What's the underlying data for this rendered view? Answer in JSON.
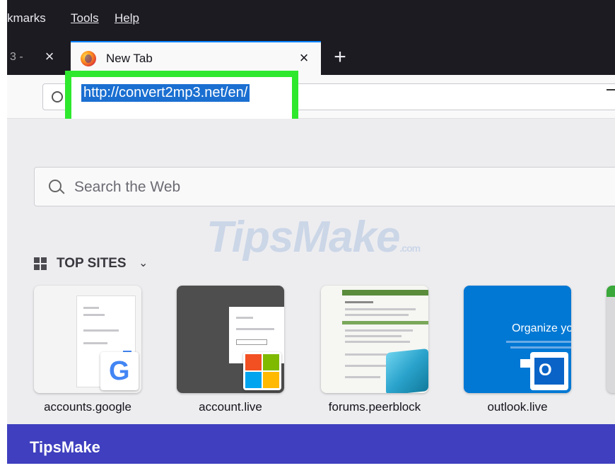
{
  "menu": {
    "items": [
      "kmarks",
      "Tools",
      "Help"
    ]
  },
  "tabs": {
    "previous_tab_fragment": "3 -",
    "active_tab_title": "New Tab",
    "new_tab_symbol": "+",
    "close_symbol": "×"
  },
  "urlbar": {
    "url": "http://convert2mp3.net/en/"
  },
  "newtab": {
    "search_placeholder": "Search the Web",
    "watermark": "TipsMake",
    "watermark_suffix": ".com",
    "top_sites_label": "TOP SITES",
    "chevron": "⌄",
    "sites": [
      {
        "label": "accounts.google",
        "icon": "google-g-icon"
      },
      {
        "label": "account.live",
        "icon": "microsoft-logo-icon"
      },
      {
        "label": "forums.peerblock",
        "icon": "peerblock-cube-icon"
      },
      {
        "label": "outlook.live",
        "icon": "outlook-icon"
      }
    ],
    "outlook_thumb_text": "Organize yo"
  },
  "footer": {
    "brand": "TipsMake"
  },
  "colors": {
    "frame": "#3f3fbf",
    "highlight": "#2ee82e",
    "selection": "#1a6fd1",
    "outlook_blue": "#0078d4"
  }
}
